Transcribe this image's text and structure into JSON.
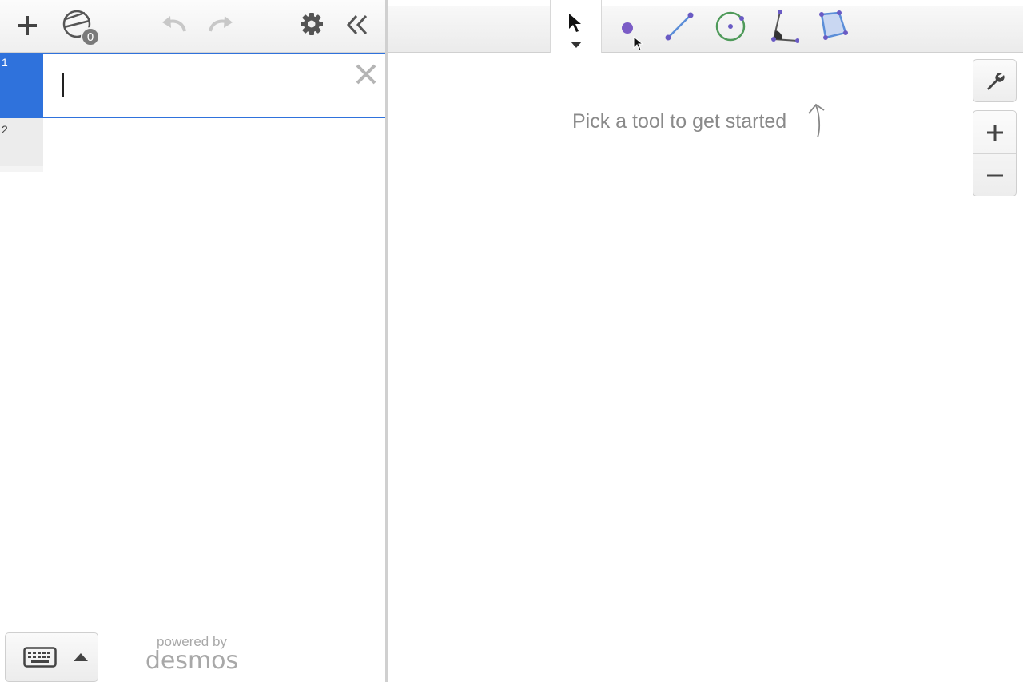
{
  "app": {
    "brand_prefix": "powered by",
    "brand_name": "desmos"
  },
  "left_toolbar": {
    "add_icon": "plus-icon",
    "construction_icon": "circle-construction-icon",
    "construction_count": "0",
    "undo_icon": "undo-icon",
    "redo_icon": "redo-icon",
    "settings_icon": "gear-icon",
    "collapse_icon": "double-chevron-left-icon"
  },
  "expressions": [
    {
      "index": "1",
      "value": "",
      "active": true
    },
    {
      "index": "2",
      "value": "",
      "active": false
    }
  ],
  "geometry_tools": [
    {
      "name": "select",
      "icon": "pointer-arrow-icon",
      "selected": true
    },
    {
      "name": "point",
      "icon": "point-icon",
      "color": "#7b5cc6"
    },
    {
      "name": "segment",
      "icon": "segment-icon",
      "color": "#5b8ed8"
    },
    {
      "name": "circle",
      "icon": "circle-icon",
      "color": "#4f9a5a"
    },
    {
      "name": "angle",
      "icon": "angle-icon",
      "color": "#6a5bc4"
    },
    {
      "name": "polygon",
      "icon": "polygon-icon",
      "color": "#6a5bc4"
    }
  ],
  "canvas": {
    "hint": "Pick a tool to get started"
  },
  "side_controls": {
    "settings_icon": "wrench-icon",
    "zoom_in_icon": "plus-icon",
    "zoom_out_icon": "minus-icon"
  },
  "colors": {
    "accent": "#2f72dc",
    "toolbar_bg": "#efefef",
    "muted_text": "#8a8a8a"
  }
}
